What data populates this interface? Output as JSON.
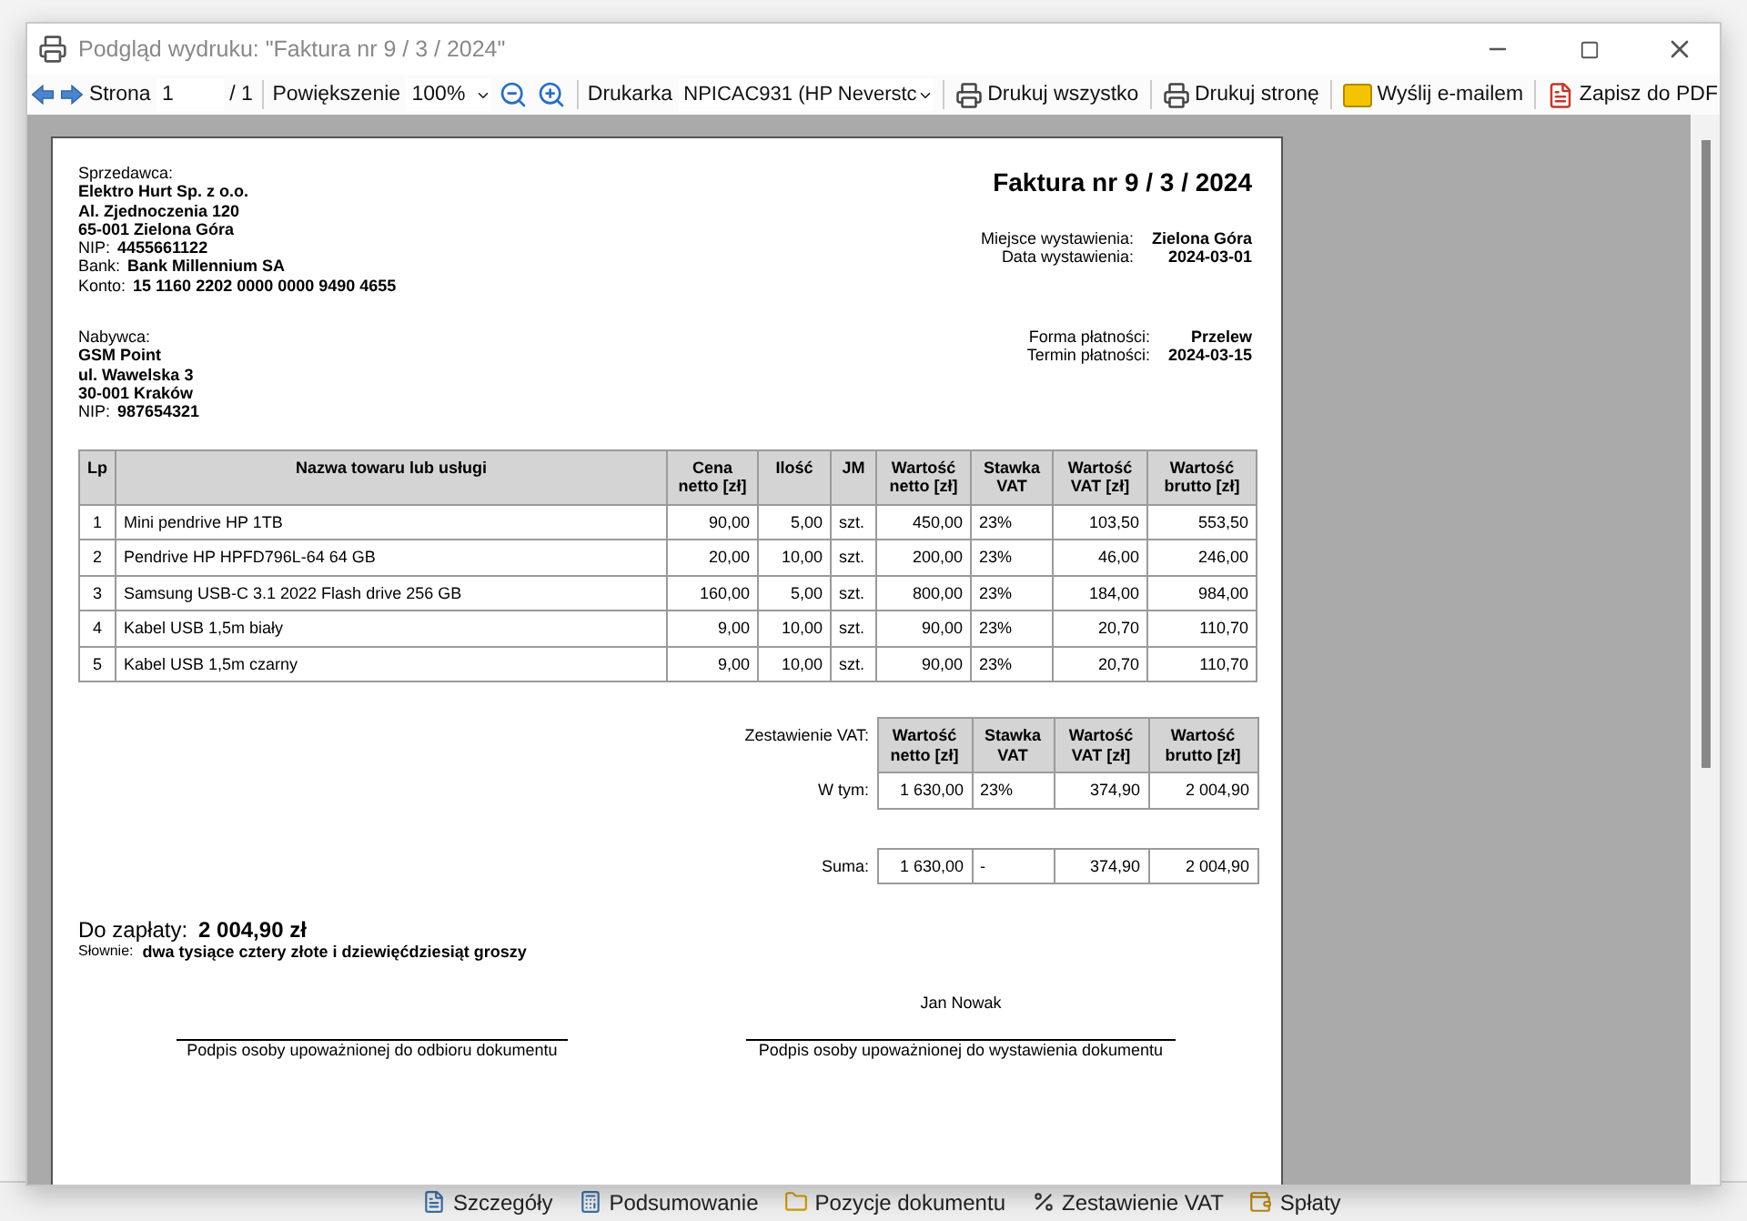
{
  "window": {
    "title": "Podgląd wydruku: \"Faktura nr 9 / 3 / 2024\""
  },
  "toolbar": {
    "page_label": "Strona",
    "page_value": "1",
    "page_total": "/ 1",
    "zoom_label": "Powiększenie",
    "zoom_value": "100%",
    "printer_label": "Drukarka",
    "printer_value": "NPICAC931 (HP Neverstc",
    "buttons": [
      {
        "kind": "print",
        "label": "Drukuj wszystko"
      },
      {
        "kind": "print",
        "label": "Drukuj stronę"
      },
      {
        "kind": "email",
        "label": "Wyślij e-mailem"
      },
      {
        "kind": "pdf",
        "label": "Zapisz do PDF"
      }
    ]
  },
  "invoice": {
    "title": "Faktura nr 9 / 3 / 2024",
    "seller": {
      "heading": "Sprzedawca:",
      "lines": [
        "Elektro Hurt Sp. z o.o.",
        "Al. Zjednoczenia 120",
        "65-001 Zielona Góra"
      ],
      "fields": [
        {
          "label": "NIP:",
          "value": "4455661122"
        },
        {
          "label": "Bank:",
          "value": "Bank Millennium SA"
        },
        {
          "label": "Konto:",
          "value": "15 1160 2202 0000 0000 9490 4655"
        }
      ]
    },
    "issue_info": [
      {
        "label": "Miejsce wystawienia:",
        "value": "Zielona Góra"
      },
      {
        "label": "Data wystawienia:",
        "value": "2024-03-01"
      }
    ],
    "buyer": {
      "heading": "Nabywca:",
      "lines": [
        "GSM Point",
        "ul. Wawelska 3",
        "30-001 Kraków"
      ],
      "fields": [
        {
          "label": "NIP:",
          "value": "987654321"
        }
      ]
    },
    "payment_info": [
      {
        "label": "Forma płatności:",
        "value": "Przelew"
      },
      {
        "label": "Termin płatności:",
        "value": "2024-03-15"
      }
    ],
    "items_table": {
      "columns": [
        "Lp",
        "Nazwa towaru lub usługi",
        "Cena netto [zł]",
        "Ilość",
        "JM",
        "Wartość netto [zł]",
        "Stawka VAT",
        "Wartość VAT [zł]",
        "Wartość brutto [zł]"
      ],
      "rows": [
        [
          "1",
          "Mini pendrive HP 1TB",
          "90,00",
          "5,00",
          "szt.",
          "450,00",
          "23%",
          "103,50",
          "553,50"
        ],
        [
          "2",
          "Pendrive HP HPFD796L-64 64 GB",
          "20,00",
          "10,00",
          "szt.",
          "200,00",
          "23%",
          "46,00",
          "246,00"
        ],
        [
          "3",
          "Samsung USB-C 3.1 2022 Flash drive 256 GB",
          "160,00",
          "5,00",
          "szt.",
          "800,00",
          "23%",
          "184,00",
          "984,00"
        ],
        [
          "4",
          "Kabel USB 1,5m biały",
          "9,00",
          "10,00",
          "szt.",
          "90,00",
          "23%",
          "20,70",
          "110,70"
        ],
        [
          "5",
          "Kabel USB 1,5m czarny",
          "9,00",
          "10,00",
          "szt.",
          "90,00",
          "23%",
          "20,70",
          "110,70"
        ]
      ]
    },
    "vat_summary": {
      "heading": "Zestawienie VAT:",
      "columns": [
        "Wartość netto [zł]",
        "Stawka VAT",
        "Wartość VAT [zł]",
        "Wartość brutto [zł]"
      ],
      "rows": [
        {
          "label": "W tym:",
          "cells": [
            "1 630,00",
            "23%",
            "374,90",
            "2 004,90"
          ]
        }
      ],
      "total": {
        "label": "Suma:",
        "cells": [
          "1 630,00",
          "-",
          "374,90",
          "2 004,90"
        ]
      }
    },
    "payment": {
      "label": "Do zapłaty:",
      "amount": "2 004,90 zł",
      "words_label": "Słownie:",
      "words": "dwa tysiące cztery złote i dziewięćdziesiąt groszy"
    },
    "signatures": {
      "issuer_name": "Jan Nowak",
      "captions": [
        "Podpis osoby upoważnionej do odbioru dokumentu",
        "Podpis osoby upoważnionej do wystawienia dokumentu"
      ]
    }
  },
  "bottom_tabs": [
    {
      "kind": "details",
      "label": "Szczegóły"
    },
    {
      "kind": "summary",
      "label": "Podsumowanie"
    },
    {
      "kind": "items",
      "label": "Pozycje dokumentu"
    },
    {
      "kind": "vat",
      "label": "Zestawienie VAT"
    },
    {
      "kind": "payments",
      "label": "Spłaty"
    }
  ]
}
